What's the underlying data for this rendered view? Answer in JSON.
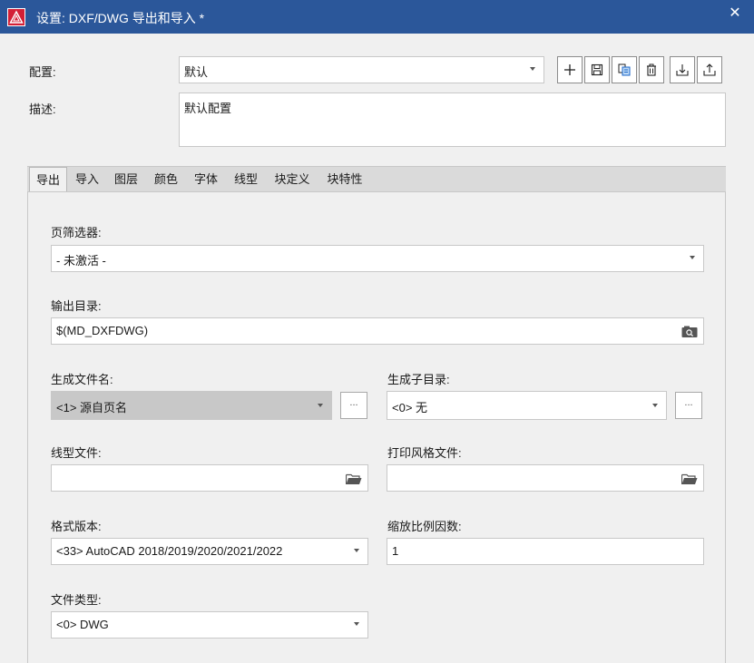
{
  "window": {
    "title": "设置: DXF/DWG 导出和导入 *",
    "close_glyph": "✕"
  },
  "header": {
    "profile_label": "配置:",
    "profile_value": "默认",
    "description_label": "描述:",
    "description_value": "默认配置",
    "toolbar": [
      "add-icon",
      "save-icon",
      "copy-icon",
      "delete-icon",
      "import-icon",
      "export-icon"
    ]
  },
  "tabs": [
    {
      "label": "导出",
      "active": true
    },
    {
      "label": "导入"
    },
    {
      "label": "图层"
    },
    {
      "label": "颜色"
    },
    {
      "label": "字体"
    },
    {
      "label": "线型"
    },
    {
      "label": "块定义"
    },
    {
      "label": "块特性"
    }
  ],
  "form": {
    "page_filter_label": "页筛选器:",
    "page_filter_value": "- 未激活 -",
    "output_dir_label": "输出目录:",
    "output_dir_value": "$(MD_DXFDWG)",
    "file_name_label": "生成文件名:",
    "file_name_value": "<1> 源自页名",
    "subdir_label": "生成子目录:",
    "subdir_value": "<0> 无",
    "linetype_file_label": "线型文件:",
    "linetype_file_value": "",
    "plot_style_label": "打印风格文件:",
    "plot_style_value": "",
    "format_label": "格式版本:",
    "format_value": "<33> AutoCAD 2018/2019/2020/2021/2022",
    "scale_label": "缩放比例因数:",
    "scale_value": "1",
    "file_type_label": "文件类型:",
    "file_type_value": "<0> DWG",
    "ellipsis": "..."
  },
  "colors": {
    "titlebar": "#2b579a",
    "app_icon": "#d31f36"
  }
}
